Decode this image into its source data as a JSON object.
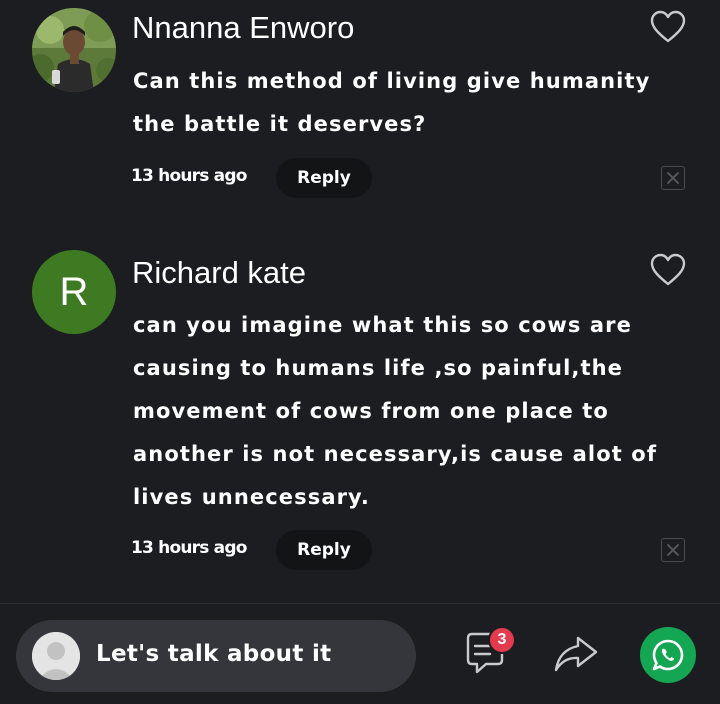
{
  "comments": [
    {
      "author": "Nnanna Enworo",
      "avatar_type": "photo",
      "text": "Can this method of living give humanity the battle it deserves?",
      "time": "13 hours ago",
      "reply_label": "Reply",
      "like_icon": "heart-icon",
      "dismiss_icon": "close-icon"
    },
    {
      "author": "Richard kate",
      "avatar_letter": "R",
      "avatar_color": "#3e7a22",
      "text": "can you imagine what this so cows are causing to humans life ,so painful,the movement of cows from one place to another is not necessary,is cause alot of lives unnecessary.",
      "time": "13 hours ago",
      "reply_label": "Reply",
      "like_icon": "heart-icon",
      "dismiss_icon": "close-icon"
    }
  ],
  "bottom_bar": {
    "input_placeholder": "Let's talk about it",
    "comment_count": "3",
    "comment_icon": "comment-icon",
    "share_icon": "share-icon",
    "whatsapp_icon": "whatsapp-icon",
    "whatsapp_color": "#15a653",
    "badge_color": "#e23a4f"
  }
}
